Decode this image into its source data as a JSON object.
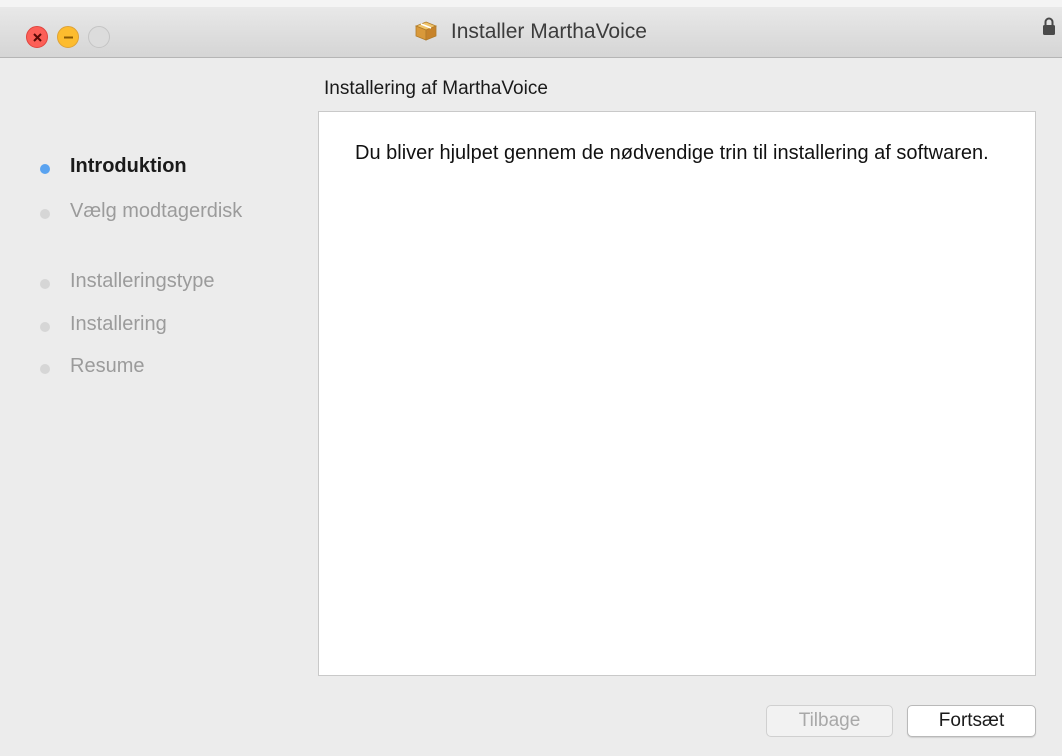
{
  "window": {
    "title": "Installer MarthaVoice",
    "buttons": {
      "close": "close",
      "minimize": "minimize",
      "zoom": "zoom"
    },
    "icons": {
      "app": "package-icon",
      "lock": "lock-icon"
    }
  },
  "main": {
    "subtitle": "Installering af MarthaVoice",
    "body_text": "Du bliver hjulpet gennem de nødvendige trin til installering af softwaren."
  },
  "steps": [
    {
      "label": "Introduktion",
      "active": true
    },
    {
      "label": "Vælg modtagerdisk",
      "active": false
    },
    {
      "label": "Installeringstype",
      "active": false
    },
    {
      "label": "Installering",
      "active": false
    },
    {
      "label": "Resume",
      "active": false
    }
  ],
  "footer": {
    "back_label": "Tilbage",
    "continue_label": "Fortsæt"
  },
  "colors": {
    "active_step_dot": "#5aa3f0",
    "inactive_step_dot": "#d6d6d6",
    "close": "#fc5f57",
    "minimize": "#fdbc2e"
  }
}
